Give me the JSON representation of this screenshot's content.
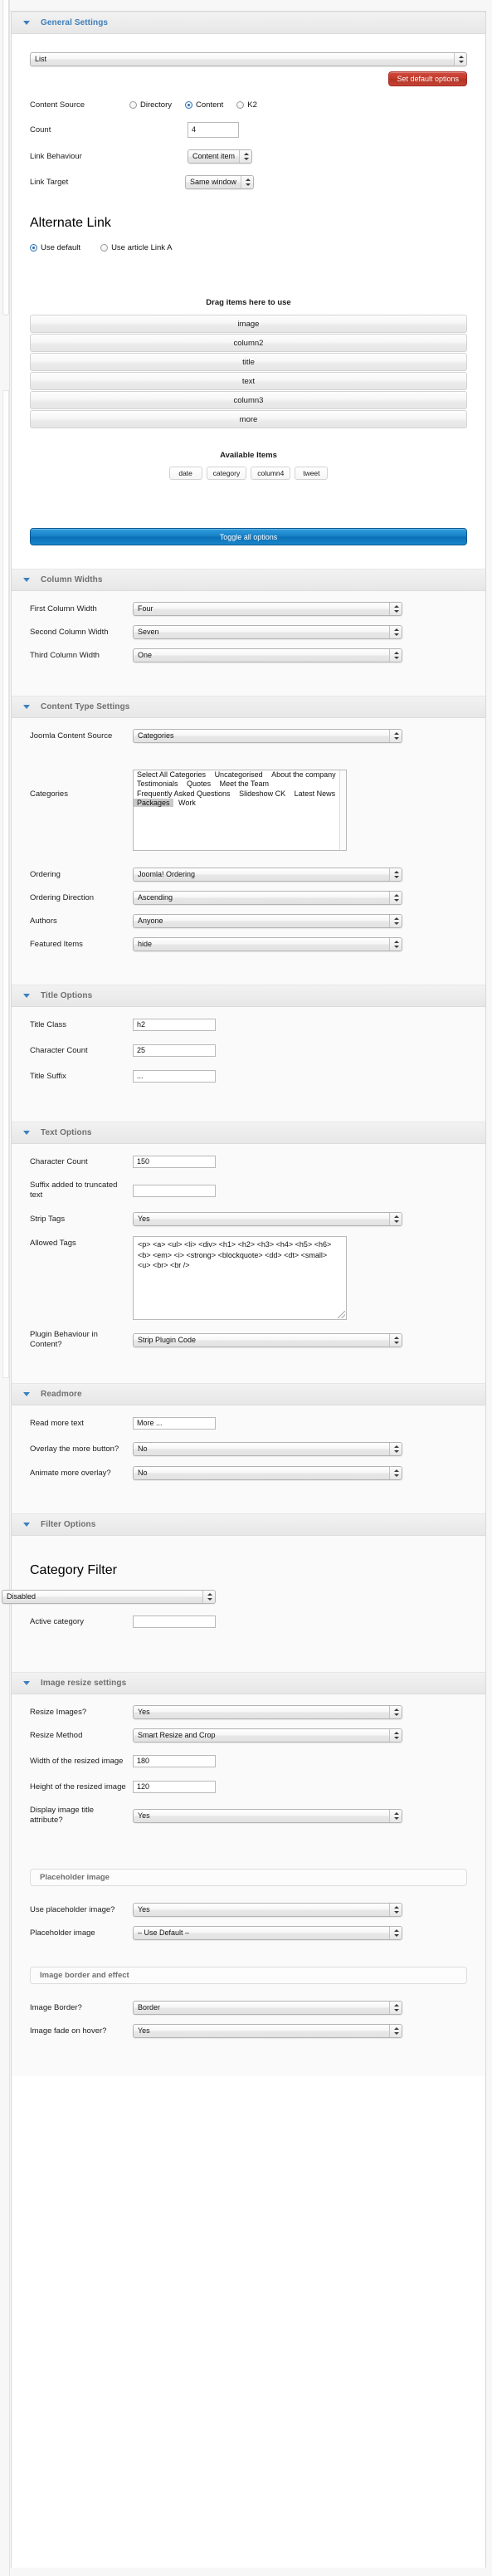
{
  "sections": {
    "general": {
      "title": "General Settings",
      "layout_select": "List",
      "set_default_button": "Set default options",
      "content_source": {
        "label": "Content Source",
        "options": [
          {
            "label": "Directory",
            "selected": false
          },
          {
            "label": "Content",
            "selected": true
          },
          {
            "label": "K2",
            "selected": false
          }
        ]
      },
      "count": {
        "label": "Count",
        "value": "4"
      },
      "link_behaviour": {
        "label": "Link Behaviour",
        "value": "Content item"
      },
      "link_target": {
        "label": "Link Target",
        "value": "Same window"
      },
      "alternate_link": {
        "label": "Alternate Link",
        "options": [
          {
            "label": "Use default",
            "selected": true
          },
          {
            "label": "Use article Link A",
            "selected": false
          }
        ]
      },
      "drag_title": "Drag items here to use",
      "drag_items": [
        "image",
        "column2",
        "title",
        "text",
        "column3",
        "more"
      ],
      "available_title": "Available Items",
      "available_items": [
        "date",
        "category",
        "column4",
        "tweet"
      ],
      "toggle_button": "Toggle all options"
    },
    "column_widths": {
      "title": "Column Widths",
      "rows": [
        {
          "label": "First Column Width",
          "value": "Four"
        },
        {
          "label": "Second Column Width",
          "value": "Seven"
        },
        {
          "label": "Third Column Width",
          "value": "One"
        }
      ]
    },
    "content_type": {
      "title": "Content Type Settings",
      "joomla_content_source": {
        "label": "Joomla Content Source",
        "value": "Categories"
      },
      "categories": {
        "label": "Categories",
        "options": [
          {
            "label": "Select All Categories",
            "selected": false
          },
          {
            "label": "Uncategorised",
            "selected": false
          },
          {
            "label": "About the company",
            "selected": false
          },
          {
            "label": "Testimonials",
            "selected": false
          },
          {
            "label": "Quotes",
            "selected": false
          },
          {
            "label": "Meet the Team",
            "selected": false
          },
          {
            "label": "Frequently Asked Questions",
            "selected": false
          },
          {
            "label": "Slideshow CK",
            "selected": false
          },
          {
            "label": "Latest News",
            "selected": false
          },
          {
            "label": "Packages",
            "selected": true
          },
          {
            "label": "Work",
            "selected": false
          }
        ]
      },
      "ordering": {
        "label": "Ordering",
        "value": "Joomla! Ordering"
      },
      "ordering_direction": {
        "label": "Ordering Direction",
        "value": "Ascending"
      },
      "authors": {
        "label": "Authors",
        "value": "Anyone"
      },
      "featured_items": {
        "label": "Featured Items",
        "value": "hide"
      }
    },
    "title_options": {
      "title": "Title Options",
      "title_class": {
        "label": "Title Class",
        "value": "h2"
      },
      "character_count": {
        "label": "Character Count",
        "value": "25"
      },
      "title_suffix": {
        "label": "Title Suffix",
        "value": "..."
      }
    },
    "text_options": {
      "title": "Text Options",
      "character_count": {
        "label": "Character Count",
        "value": "150"
      },
      "suffix_truncated": {
        "label": "Suffix added to truncated text",
        "value": ""
      },
      "strip_tags": {
        "label": "Strip Tags",
        "value": "Yes"
      },
      "allowed_tags": {
        "label": "Allowed Tags",
        "value": "<p> <a> <ul> <li> <div> <h1> <h2> <h3> <h4> <h5> <h6> <b> <em> <i> <strong> <blockquote> <dd> <dt> <small> <u> <br> <br />"
      },
      "plugin_behaviour": {
        "label": "Plugin Behaviour in Content?",
        "value": "Strip Plugin Code"
      }
    },
    "readmore": {
      "title": "Readmore",
      "read_more_text": {
        "label": "Read more text",
        "value": "More ..."
      },
      "overlay_more": {
        "label": "Overlay the more button?",
        "value": "No"
      },
      "animate_overlay": {
        "label": "Animate more overlay?",
        "value": "No"
      }
    },
    "filter_options": {
      "title": "Filter Options",
      "category_filter": {
        "label": "Category Filter",
        "value": "Disabled"
      },
      "active_category": {
        "label": "Active category",
        "value": ""
      }
    },
    "image_resize": {
      "title": "Image resize settings",
      "resize_images": {
        "label": "Resize Images?",
        "value": "Yes"
      },
      "resize_method": {
        "label": "Resize Method",
        "value": "Smart Resize and Crop"
      },
      "width": {
        "label": "Width of the resized image",
        "value": "180"
      },
      "height": {
        "label": "Height of the resized image",
        "value": "120"
      },
      "display_title_attr": {
        "label": "Display image title attribute?",
        "value": "Yes"
      },
      "placeholder_heading": "Placeholder image",
      "use_placeholder": {
        "label": "Use placeholder image?",
        "value": "Yes"
      },
      "placeholder_image": {
        "label": "Placeholder image",
        "value": "– Use Default –"
      },
      "border_heading": "Image border and effect",
      "image_border": {
        "label": "Image Border?",
        "value": "Border"
      },
      "image_fade": {
        "label": "Image fade on hover?",
        "value": "Yes"
      }
    }
  },
  "colors": {
    "accent_blue": "#3d7eb8",
    "button_red": "#c03a2c",
    "button_blue": "#1680c6",
    "section_grey": "#6f6f6f"
  }
}
